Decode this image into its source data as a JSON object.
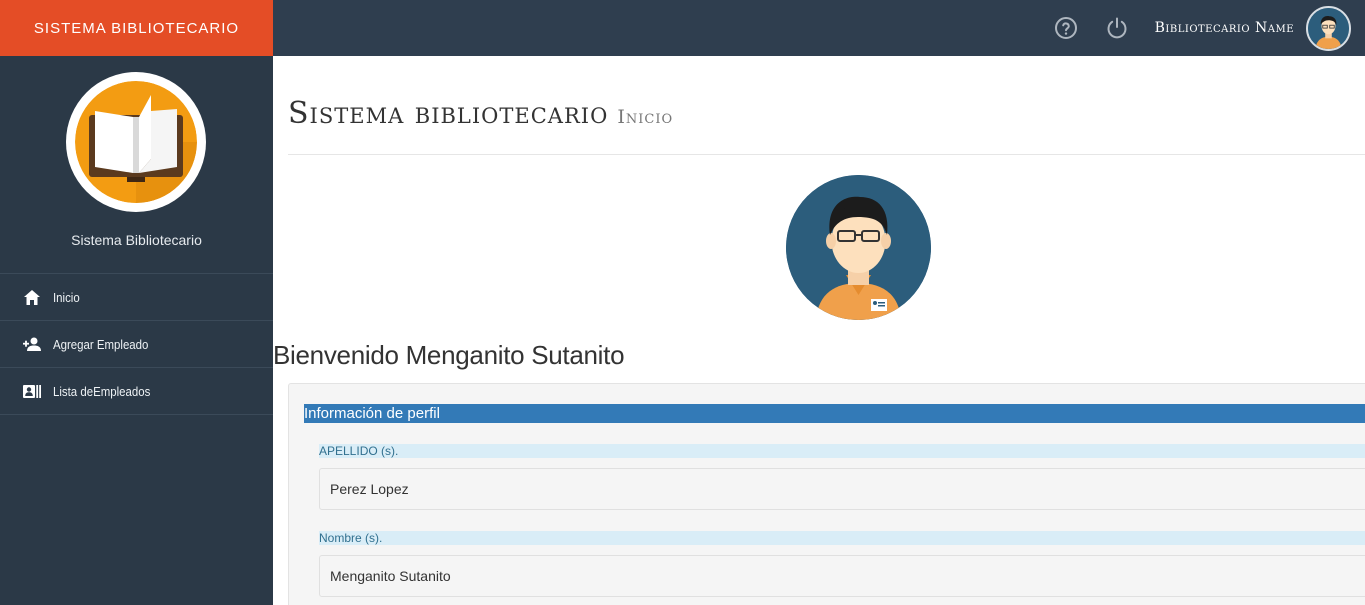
{
  "app": {
    "brand": "SISTEMA BIBLIOTECARIO",
    "brand_color": "#e44d26"
  },
  "navbar": {
    "help_icon": "question-circle-icon",
    "power_icon": "power-icon",
    "user_name": "Bibliotecario Name"
  },
  "sidebar": {
    "logo_icon": "open-book-icon",
    "title": "Sistema Bibliotecario",
    "items": [
      {
        "icon": "home-icon",
        "label": "Inicio"
      },
      {
        "icon": "add-user-icon",
        "label": "Agregar Empleado"
      },
      {
        "icon": "id-card-icon",
        "label": "Lista deEmpleados"
      }
    ]
  },
  "main": {
    "heading": "Sistema bibliotecario",
    "subheading": "Inicio",
    "welcome": "Bienvenido Menganito Sutanito",
    "panel": {
      "title": "Información de perfil",
      "fields": [
        {
          "label": "APELLIDO (s).",
          "value": "Perez Lopez"
        },
        {
          "label": "Nombre (s).",
          "value": "Menganito Sutanito"
        }
      ]
    }
  },
  "colors": {
    "topbar": "#2f3e4f",
    "sidebar": "#2b3947",
    "panel_title": "#337ab7",
    "field_label": "#d9edf7"
  }
}
